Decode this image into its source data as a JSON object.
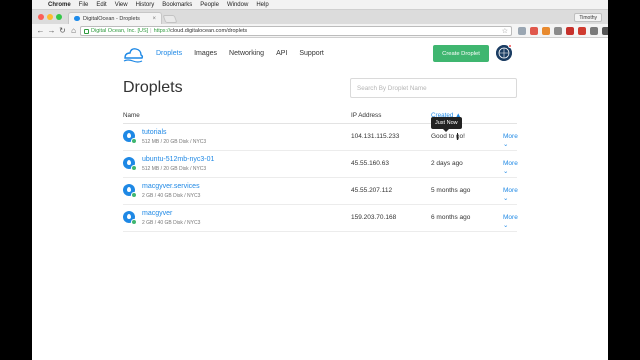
{
  "menubar": {
    "app": "Chrome",
    "items": [
      "File",
      "Edit",
      "View",
      "History",
      "Bookmarks",
      "People",
      "Window",
      "Help"
    ]
  },
  "browser": {
    "tab_title": "DigitalOcean - Droplets",
    "tab_close": "×",
    "user": "Timothy",
    "ev_label": "Digital Ocean, Inc. [US]",
    "url_scheme": "https://",
    "url_rest": "cloud.digitalocean.com/droplets",
    "nav_back": "←",
    "nav_forward": "→",
    "nav_reload": "↻",
    "nav_home": "⌂",
    "star": "☆"
  },
  "nav": {
    "links": [
      "Droplets",
      "Images",
      "Networking",
      "API",
      "Support"
    ],
    "create_label": "Create Droplet"
  },
  "page": {
    "title": "Droplets",
    "search_placeholder": "Search By Droplet Name"
  },
  "table": {
    "headers": {
      "name": "Name",
      "ip": "IP Address",
      "created": "Created ▲"
    },
    "tooltip": "Just Now",
    "rows": [
      {
        "name": "tutorials",
        "spec": "512 MB / 20 GB Disk / NYC3",
        "ip": "104.131.115.233",
        "created": "Good to go!",
        "more": "More ⌄"
      },
      {
        "name": "ubuntu-512mb-nyc3-01",
        "spec": "512 MB / 20 GB Disk / NYC3",
        "ip": "45.55.160.63",
        "created": "2 days ago",
        "more": "More ⌄"
      },
      {
        "name": "macgyver.services",
        "spec": "2 GB / 40 GB Disk / NYC3",
        "ip": "45.55.207.112",
        "created": "5 months ago",
        "more": "More ⌄"
      },
      {
        "name": "macgyver",
        "spec": "2 GB / 40 GB Disk / NYC3",
        "ip": "159.203.70.168",
        "created": "6 months ago",
        "more": "More ⌄"
      }
    ]
  },
  "colors": {
    "accent": "#1e88e5",
    "create_button": "#3fb670"
  }
}
